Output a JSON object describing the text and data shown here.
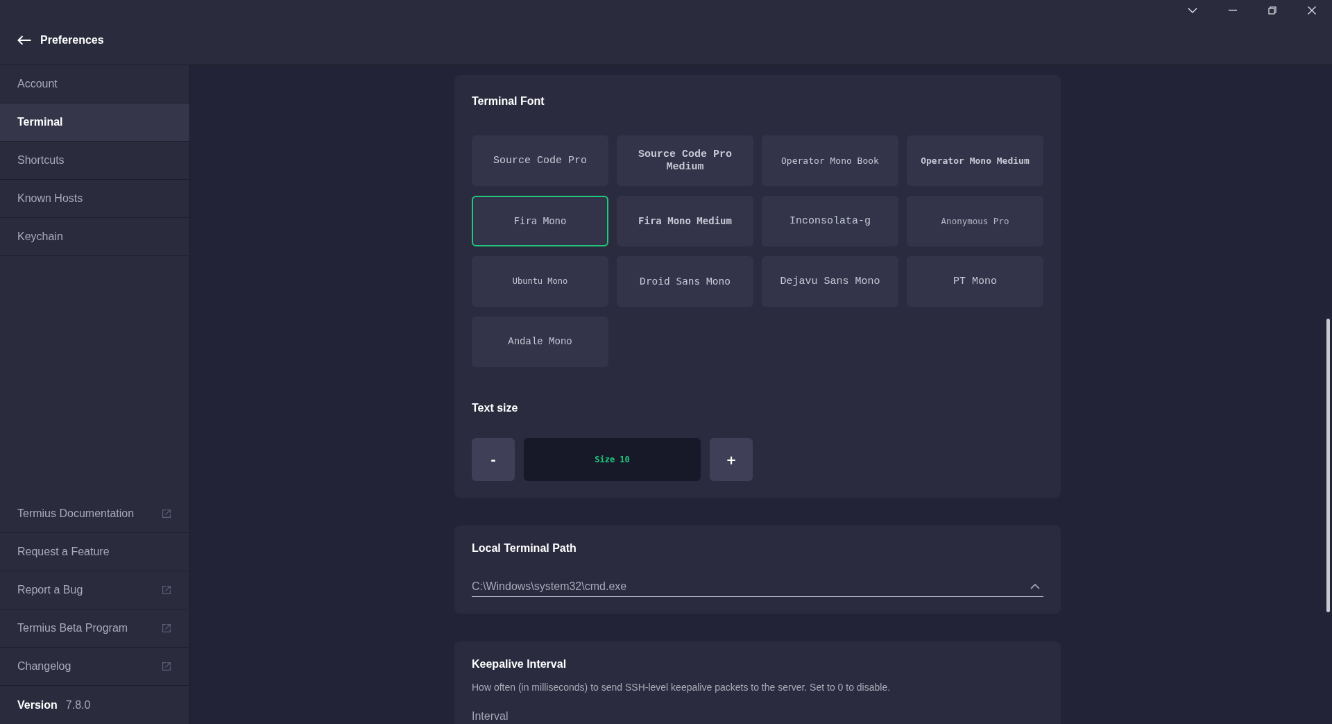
{
  "header": {
    "title": "Preferences"
  },
  "sidebar": {
    "items": [
      {
        "label": "Account",
        "selected": false
      },
      {
        "label": "Terminal",
        "selected": true
      },
      {
        "label": "Shortcuts",
        "selected": false
      },
      {
        "label": "Known Hosts",
        "selected": false
      },
      {
        "label": "Keychain",
        "selected": false
      }
    ],
    "links": [
      {
        "label": "Termius Documentation",
        "external": true
      },
      {
        "label": "Request a Feature",
        "external": false
      },
      {
        "label": "Report a Bug",
        "external": true
      },
      {
        "label": "Termius Beta Program",
        "external": true
      },
      {
        "label": "Changelog",
        "external": true
      }
    ],
    "version": {
      "label": "Version",
      "value": "7.8.0"
    }
  },
  "terminal_font": {
    "title": "Terminal Font",
    "fonts": [
      {
        "label": "Source Code Pro",
        "selected": false
      },
      {
        "label": "Source Code Pro Medium",
        "selected": false
      },
      {
        "label": "Operator Mono Book",
        "selected": false
      },
      {
        "label": "Operator Mono Medium",
        "selected": false
      },
      {
        "label": "Fira Mono",
        "selected": true
      },
      {
        "label": "Fira Mono Medium",
        "selected": false
      },
      {
        "label": "Inconsolata-g",
        "selected": false
      },
      {
        "label": "Anonymous Pro",
        "selected": false
      },
      {
        "label": "Ubuntu Mono",
        "selected": false
      },
      {
        "label": "Droid Sans Mono",
        "selected": false
      },
      {
        "label": "Dejavu Sans Mono",
        "selected": false
      },
      {
        "label": "PT Mono",
        "selected": false
      },
      {
        "label": "Andale Mono",
        "selected": false
      }
    ]
  },
  "text_size": {
    "title": "Text size",
    "decrease": "-",
    "value": "Size 10",
    "increase": "+"
  },
  "local_terminal_path": {
    "title": "Local Terminal Path",
    "value": "C:\\Windows\\system32\\cmd.exe"
  },
  "keepalive_interval": {
    "title": "Keepalive Interval",
    "description": "How often (in milliseconds) to send SSH-level keepalive packets to the server. Set to 0 to disable.",
    "field_label": "Interval"
  }
}
